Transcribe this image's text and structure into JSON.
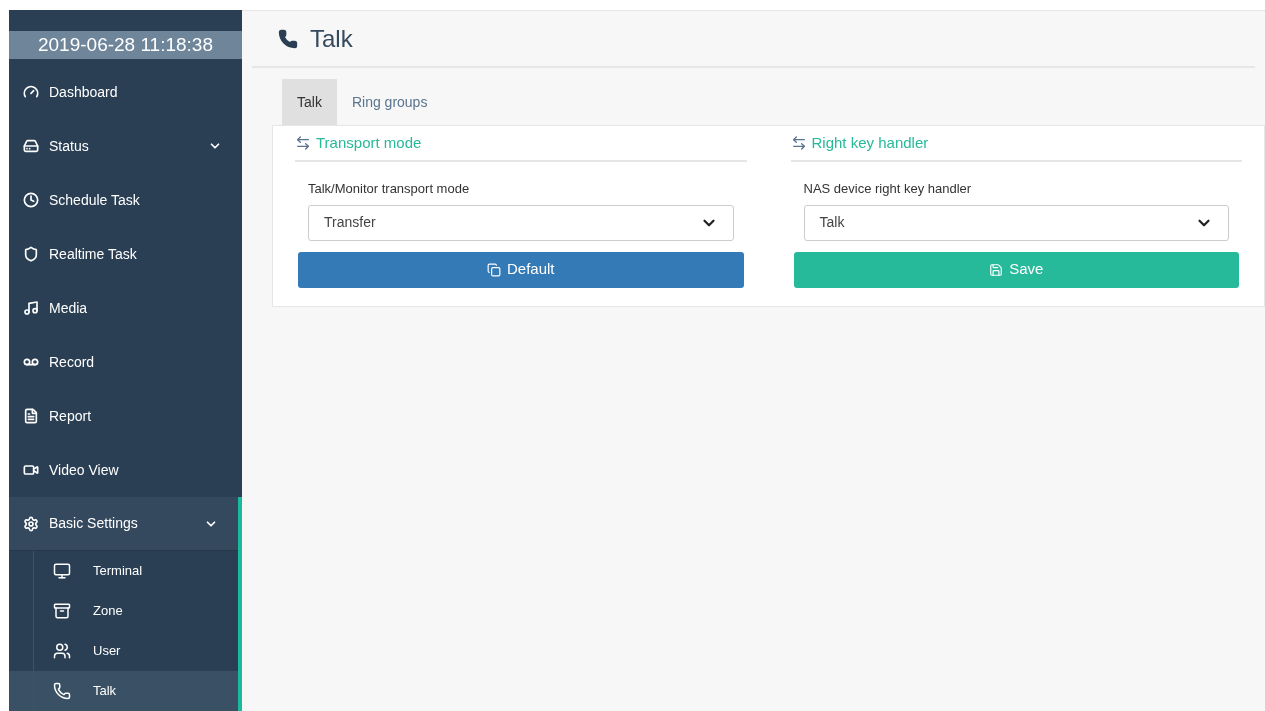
{
  "sidebar": {
    "datetime": "2019-06-28 11:18:38",
    "items": [
      {
        "label": "Dashboard"
      },
      {
        "label": "Status",
        "expanded": false
      },
      {
        "label": "Schedule Task"
      },
      {
        "label": "Realtime Task"
      },
      {
        "label": "Media"
      },
      {
        "label": "Record"
      },
      {
        "label": "Report"
      },
      {
        "label": "Video View"
      },
      {
        "label": "Basic Settings",
        "expanded": true,
        "children": [
          {
            "label": "Terminal",
            "selected": false
          },
          {
            "label": "Zone",
            "selected": false
          },
          {
            "label": "User",
            "selected": false
          },
          {
            "label": "Talk",
            "selected": true
          }
        ]
      }
    ]
  },
  "page": {
    "title": "Talk",
    "tabs": [
      {
        "label": "Talk",
        "selected": true
      },
      {
        "label": "Ring groups",
        "selected": false
      }
    ],
    "panels": [
      {
        "heading": "Transport mode",
        "field": {
          "label": "Talk/Monitor transport mode",
          "value": "Transfer"
        },
        "button": {
          "kind": "default",
          "label": "Default"
        }
      },
      {
        "heading": "Right key handler",
        "field": {
          "label": "NAS device right key handler",
          "value": "Talk"
        },
        "button": {
          "kind": "save",
          "label": "Save"
        }
      }
    ]
  }
}
